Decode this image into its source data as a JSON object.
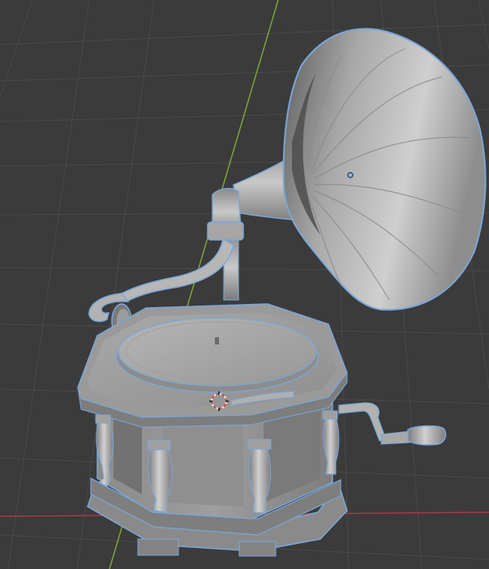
{
  "viewport": {
    "background": "#3b3b3b",
    "grid_color": "#4a4a4a",
    "axis_x_color": "#a83a44",
    "axis_y_color": "#7ea33a",
    "selection_outline_color": "#7aa7d8"
  },
  "scene": {
    "objects": [
      {
        "name": "gramophone-horn",
        "selected": true
      },
      {
        "name": "gramophone-tonearm",
        "selected": true
      },
      {
        "name": "gramophone-soundbox",
        "selected": true
      },
      {
        "name": "gramophone-turntable",
        "selected": true
      },
      {
        "name": "gramophone-cabinet",
        "selected": true
      },
      {
        "name": "gramophone-crank",
        "selected": true
      }
    ],
    "gizmos": [
      "3d-cursor",
      "object-origin"
    ]
  }
}
